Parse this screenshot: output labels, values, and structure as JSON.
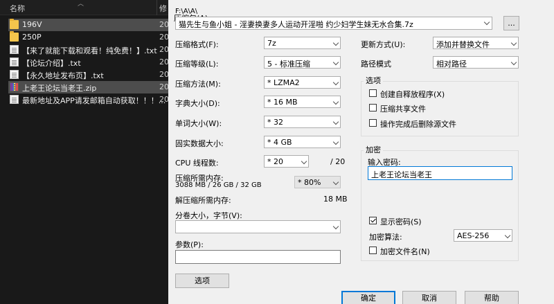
{
  "explorer": {
    "col_name": "名称",
    "col_modified": "修",
    "files": [
      {
        "name": "196V",
        "date": "20",
        "type": "folder",
        "selected": true
      },
      {
        "name": "250P",
        "date": "20",
        "type": "folder",
        "selected": false
      },
      {
        "name": "【来了就能下载和观看！纯免费！】.txt",
        "date": "20",
        "type": "doc",
        "selected": false
      },
      {
        "name": "【论坛介绍】.txt",
        "date": "20",
        "type": "doc",
        "selected": false
      },
      {
        "name": "【永久地址发布页】.txt",
        "date": "20",
        "type": "doc",
        "selected": false
      },
      {
        "name": "上老王论坛当老王.zip",
        "date": "20",
        "type": "zip",
        "selected": true
      },
      {
        "name": "最新地址及APP请发邮箱自动获取！！！...",
        "date": "20",
        "type": "doc",
        "selected": false
      }
    ]
  },
  "dialog": {
    "archive_label": "压缩包(A):",
    "archive_path": "F:\\A\\A\\",
    "archive_name": "猫先生与鱼小姐 - 淫妻换妻多人运动开淫啪 约少妇学生妹无水合集.7z",
    "browse_label": "...",
    "format_label": "压缩格式(F):",
    "format_value": "7z",
    "level_label": "压缩等级(L):",
    "level_value": "5 - 标准压缩",
    "method_label": "压缩方法(M):",
    "method_value": "* LZMA2",
    "dict_label": "字典大小(D):",
    "dict_value": "* 16 MB",
    "word_label": "单词大小(W):",
    "word_value": "* 32",
    "solid_label": "固实数据大小:",
    "solid_value": "* 4 GB",
    "cpu_label": "CPU 线程数:",
    "cpu_value": "* 20",
    "cpu_total": "/ 20",
    "mem_compress_label": "压缩所需内存:",
    "mem_compress_value": "3088 MB / 26 GB / 32 GB",
    "mem_percent_value": "* 80%",
    "mem_decompress_label": "解压缩所需内存:",
    "mem_decompress_value": "18 MB",
    "split_label": "分卷大小，字节(V):",
    "split_value": "",
    "params_label": "参数(P):",
    "params_value": "",
    "options_btn": "选项",
    "update_label": "更新方式(U):",
    "update_value": "添加并替换文件",
    "path_label": "路径模式",
    "path_value": "相对路径",
    "options_group": "选项",
    "opt_sfx": "创建自释放程序(X)",
    "opt_shared": "压缩共享文件",
    "opt_delete": "操作完成后删除源文件",
    "encrypt_group": "加密",
    "password_label": "输入密码:",
    "password_value": "上老王论坛当老王",
    "show_password": "显示密码(S)",
    "enc_method_label": "加密算法:",
    "enc_method_value": "AES-256",
    "enc_names": "加密文件名(N)",
    "ok": "确定",
    "cancel": "取消",
    "help": "帮助"
  }
}
